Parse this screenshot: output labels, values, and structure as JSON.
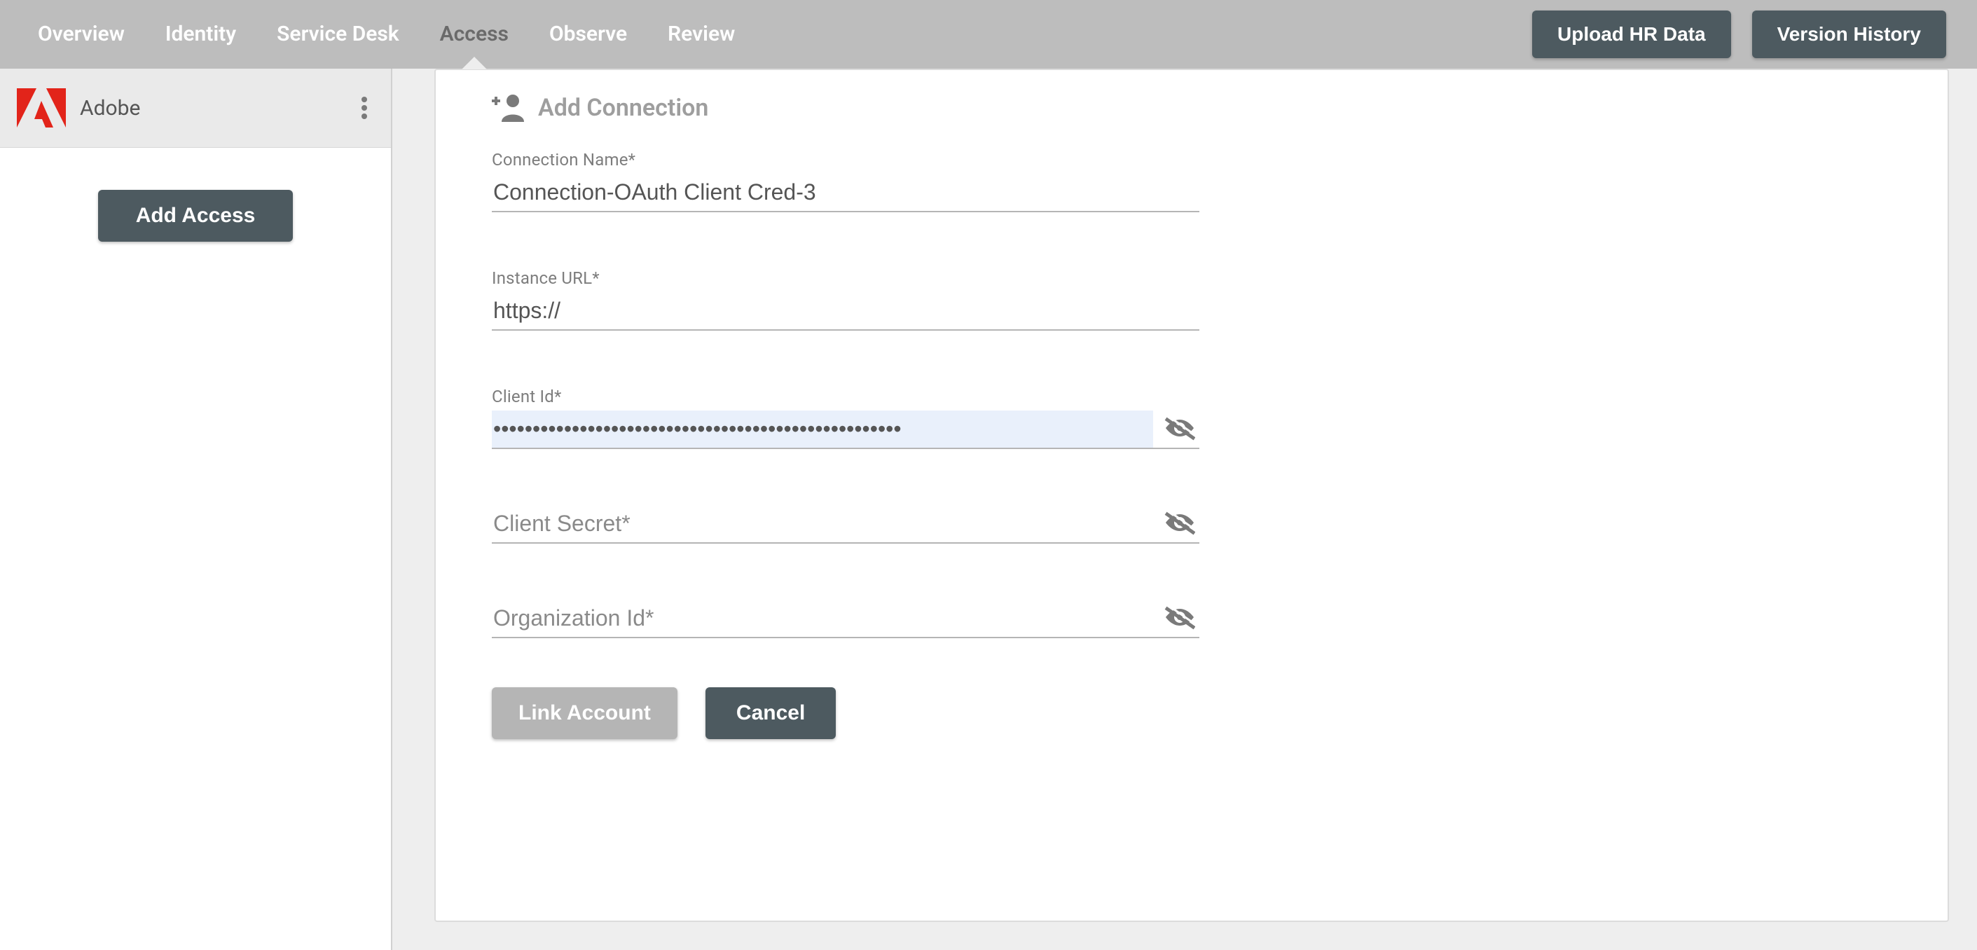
{
  "nav": {
    "tabs": [
      "Overview",
      "Identity",
      "Service Desk",
      "Access",
      "Observe",
      "Review"
    ],
    "active_index": 3,
    "actions": {
      "upload": "Upload HR Data",
      "version": "Version History"
    }
  },
  "sidebar": {
    "items": [
      {
        "label": "Adobe"
      }
    ],
    "add_access_label": "Add Access"
  },
  "card": {
    "title": "Add Connection"
  },
  "form": {
    "connection_name": {
      "label": "Connection Name*",
      "value": "Connection-OAuth Client Cred-3"
    },
    "instance_url": {
      "label": "Instance URL*",
      "value": "https://"
    },
    "client_id": {
      "label": "Client Id*",
      "masked_value": "••••••••••••••••••••••••••••••••••••••••••••••••••••"
    },
    "client_secret": {
      "label": "Client Secret*",
      "value": ""
    },
    "organization_id": {
      "label": "Organization Id*",
      "value": ""
    },
    "actions": {
      "link": "Link Account",
      "cancel": "Cancel"
    }
  }
}
